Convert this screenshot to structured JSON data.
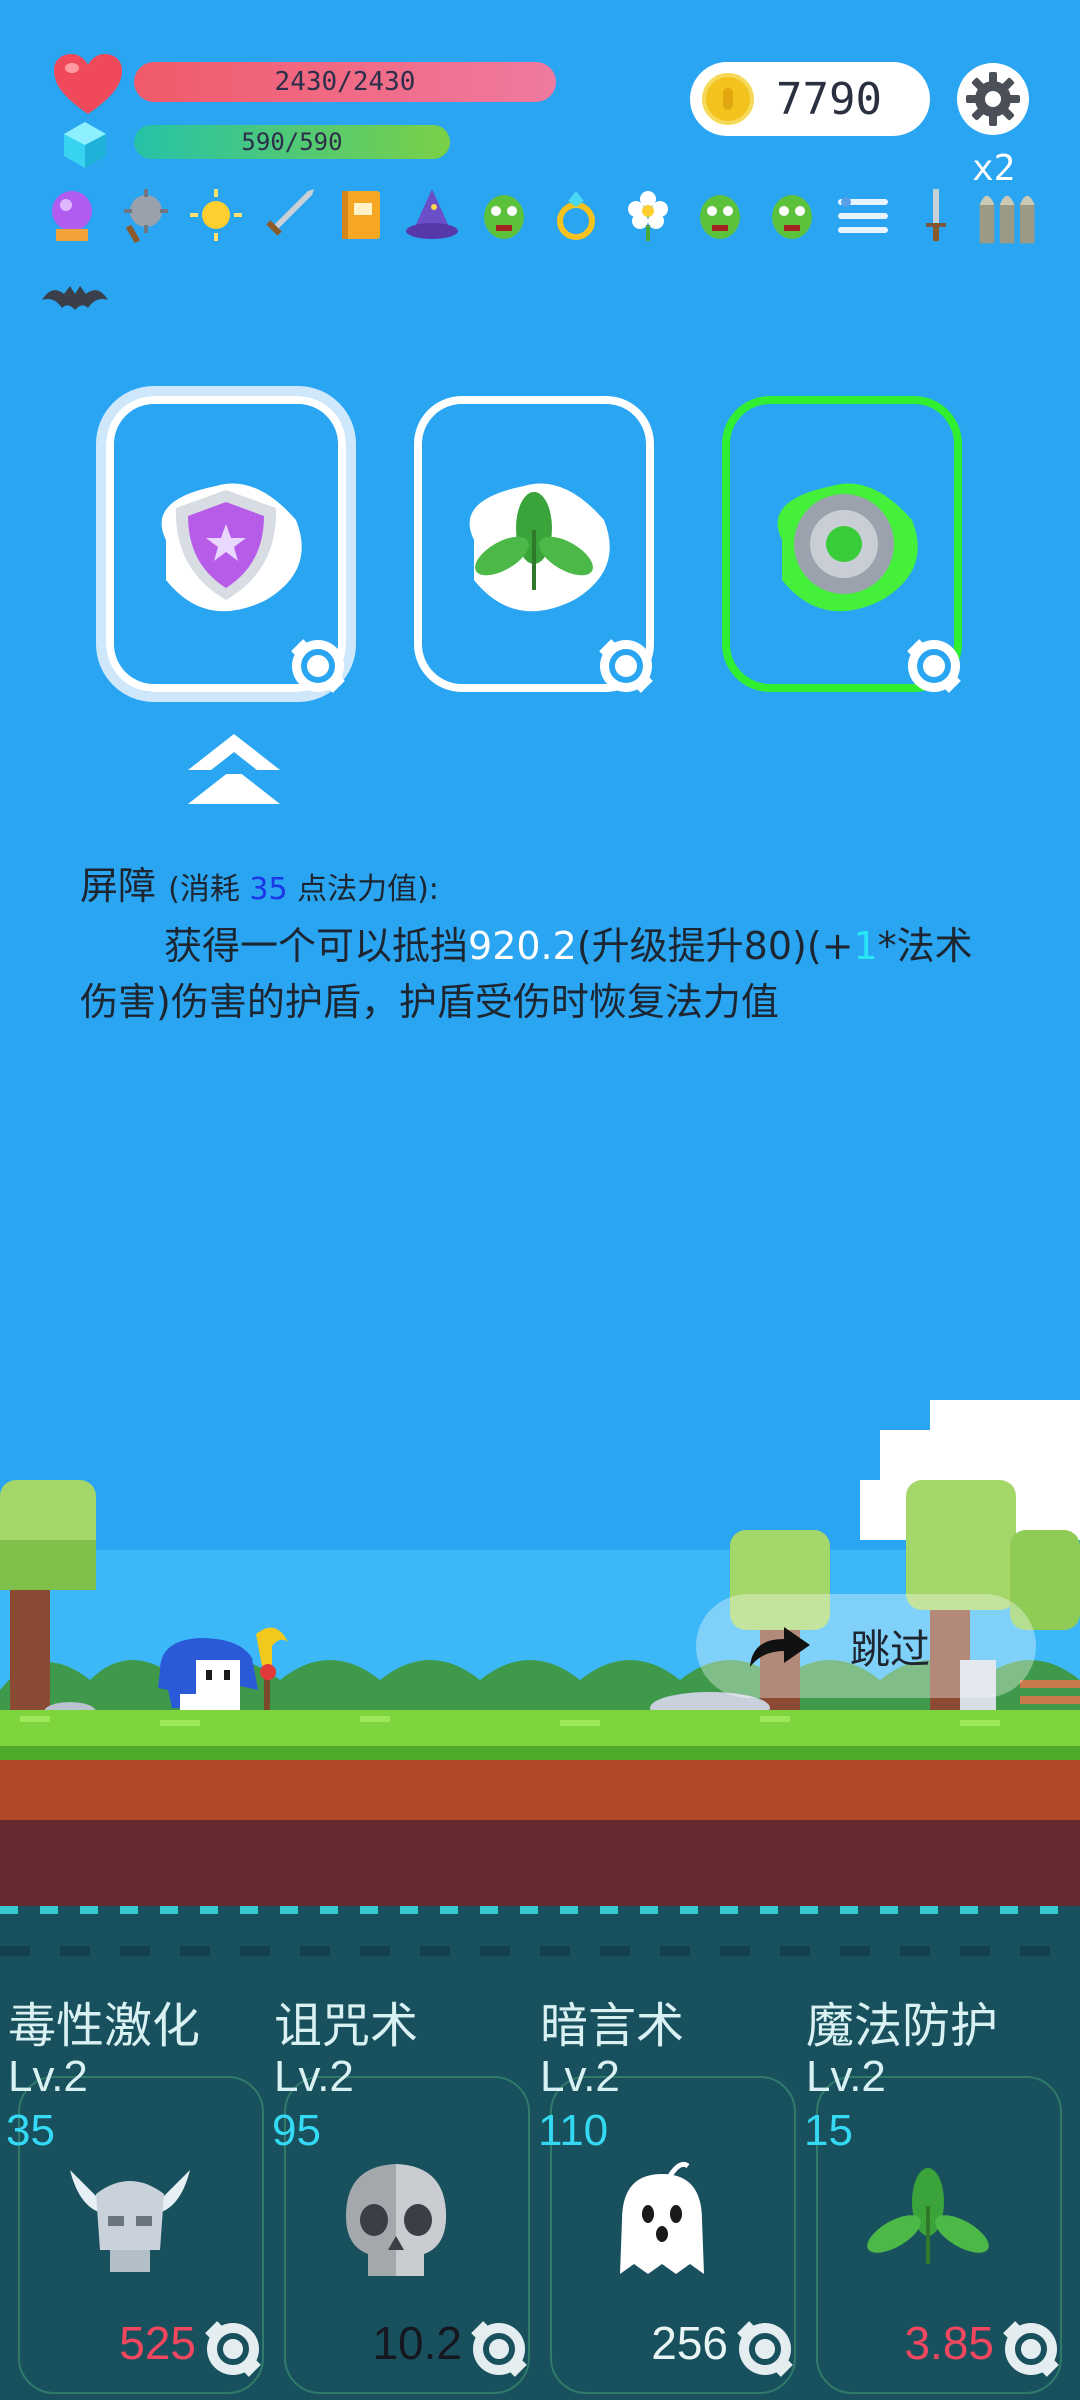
{
  "hud": {
    "hp_text": "2430/2430",
    "mp_text": "590/590",
    "coins": "7790",
    "multiplier": "x2"
  },
  "items": [
    "crystal-ball-icon",
    "spiked-mace-icon",
    "sun-orb-icon",
    "sword-icon",
    "spell-book-icon",
    "wizard-hat-icon",
    "green-goblin-icon",
    "gold-ring-icon",
    "white-flower-icon",
    "green-goblin-icon",
    "green-goblin-icon",
    "speed-lines-icon",
    "dagger-icon",
    "bullets-icon"
  ],
  "skill_choices": [
    {
      "name": "shield-skill",
      "selected": true
    },
    {
      "name": "leaf-skill",
      "selected": false
    },
    {
      "name": "green-vortex-skill",
      "selected": false
    }
  ],
  "description": {
    "title": "屏障",
    "cost_prefix": "(消耗 ",
    "cost_value": "35",
    "cost_suffix": " 点法力值):",
    "line_a": "获得一个可以抵挡",
    "shield_value": "920.2",
    "line_b": "(升级提升80)(+",
    "mult_value": "1",
    "line_c": "*法术伤害)伤害的护盾，护盾受伤时恢复法力值"
  },
  "skip_label": "跳过",
  "skills": [
    {
      "name": "毒性激化",
      "level": "Lv.2",
      "cost": "35",
      "value": "525",
      "value_color": "#f2475e",
      "icon": "horned-skull-icon"
    },
    {
      "name": "诅咒术",
      "level": "Lv.2",
      "cost": "95",
      "value": "10.2",
      "value_color": "#14181e",
      "icon": "skull-icon"
    },
    {
      "name": "暗言术",
      "level": "Lv.2",
      "cost": "110",
      "value": "256",
      "value_color": "#e9f4f4",
      "icon": "ghost-icon"
    },
    {
      "name": "魔法防护",
      "level": "Lv.2",
      "cost": "15",
      "value": "3.85",
      "value_color": "#f2475e",
      "icon": "green-leaves-icon"
    }
  ]
}
